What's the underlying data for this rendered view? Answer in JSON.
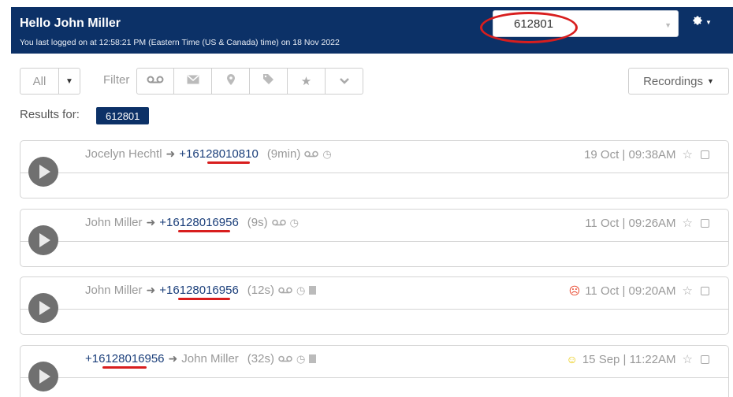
{
  "header": {
    "greeting": "Hello John Miller",
    "last_login": "You last logged on at 12:58:21 PM (Eastern Time (US & Canada) time) on 18 Nov 2022",
    "search_value": "612801",
    "settings_icon": "gear-icon",
    "background": "#0c3167"
  },
  "toolbar": {
    "all_label": "All",
    "filter_label": "Filter",
    "filter_icons": [
      "voicemail-icon",
      "envelope-icon",
      "map-pin-icon",
      "tag-icon",
      "star-icon",
      "chevron-down-icon"
    ],
    "recordings_label": "Recordings"
  },
  "results": {
    "label": "Results for:",
    "query": "612801"
  },
  "recordings": [
    {
      "from": "Jocelyn Hechtl",
      "to": "+16128010810",
      "duration": "(9min)",
      "date": "19 Oct | 09:38AM",
      "has_transcript": false,
      "sentiment": ""
    },
    {
      "from": "John Miller",
      "to": "+16128016956",
      "duration": "(9s)",
      "date": "11 Oct | 09:26AM",
      "has_transcript": false,
      "sentiment": ""
    },
    {
      "from": "John Miller",
      "to": "+16128016956",
      "duration": "(12s)",
      "date": "11 Oct | 09:20AM",
      "has_transcript": true,
      "sentiment": "sad"
    },
    {
      "from": "+16128016956",
      "to": "John Miller",
      "duration": "(32s)",
      "date": "15 Sep | 11:22AM",
      "has_transcript": true,
      "sentiment": "neutral"
    }
  ],
  "colors": {
    "accent": "#0c3167",
    "annotation_red": "#d81e1e",
    "number_link": "#1a3e7a"
  }
}
